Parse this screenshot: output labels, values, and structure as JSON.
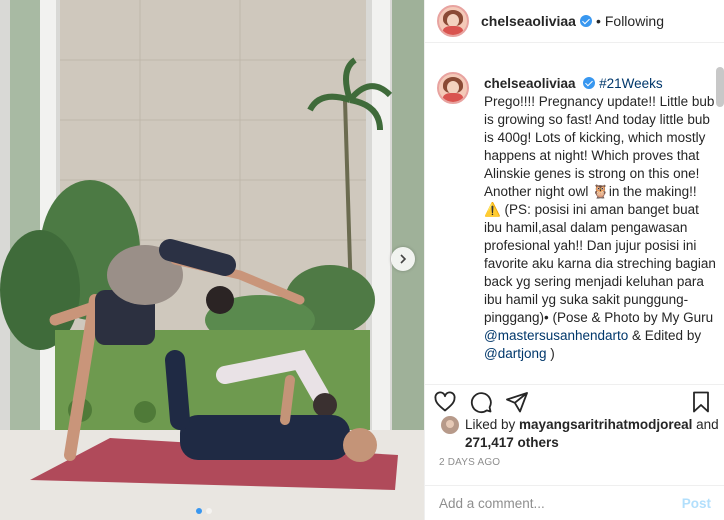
{
  "header": {
    "username": "chelseaoliviaa",
    "separator": "•",
    "follow_status": "Following"
  },
  "caption": {
    "username": "chelseaoliviaa",
    "hashtag": "#21Weeks",
    "part1": "Prego!!!! Pregnancy update!! Little bub is growing so fast! And today little bub is 400g! Lots of kicking, which mostly happens at night! Which proves that Alinskie genes is strong on this one! Another night owl 🦉in the making!! ⚠️ (PS: posisi ini aman banget buat ibu hamil,asal dalam pengawasan profesional yah!! Dan jujur posisi ini favorite aku karna dia streching bagian back yg sering menjadi keluhan para ibu hamil yg suka sakit punggung-pinggang)• (Pose & Photo by My Guru ",
    "mention1": "@mastersusanhendarto",
    "part2": " & Edited by ",
    "mention2": "@dartjong",
    "part3": " )",
    "age": "2d"
  },
  "likes": {
    "prefix": "Liked by ",
    "liked_by": "mayangsaritrihatmodjoreal",
    "and": " and",
    "count": "271,417 others"
  },
  "date": "2 DAYS AGO",
  "comment": {
    "placeholder": "Add a comment...",
    "post_label": "Post"
  },
  "icons": {
    "like": "heart-icon",
    "comment": "comment-icon",
    "share": "share-icon",
    "save": "bookmark-icon",
    "next": "chevron-right-icon"
  },
  "colors": {
    "verified": "#3897f0",
    "link": "#00376b",
    "post_disabled": "#b2dffc",
    "mat": "#b04a5a"
  }
}
